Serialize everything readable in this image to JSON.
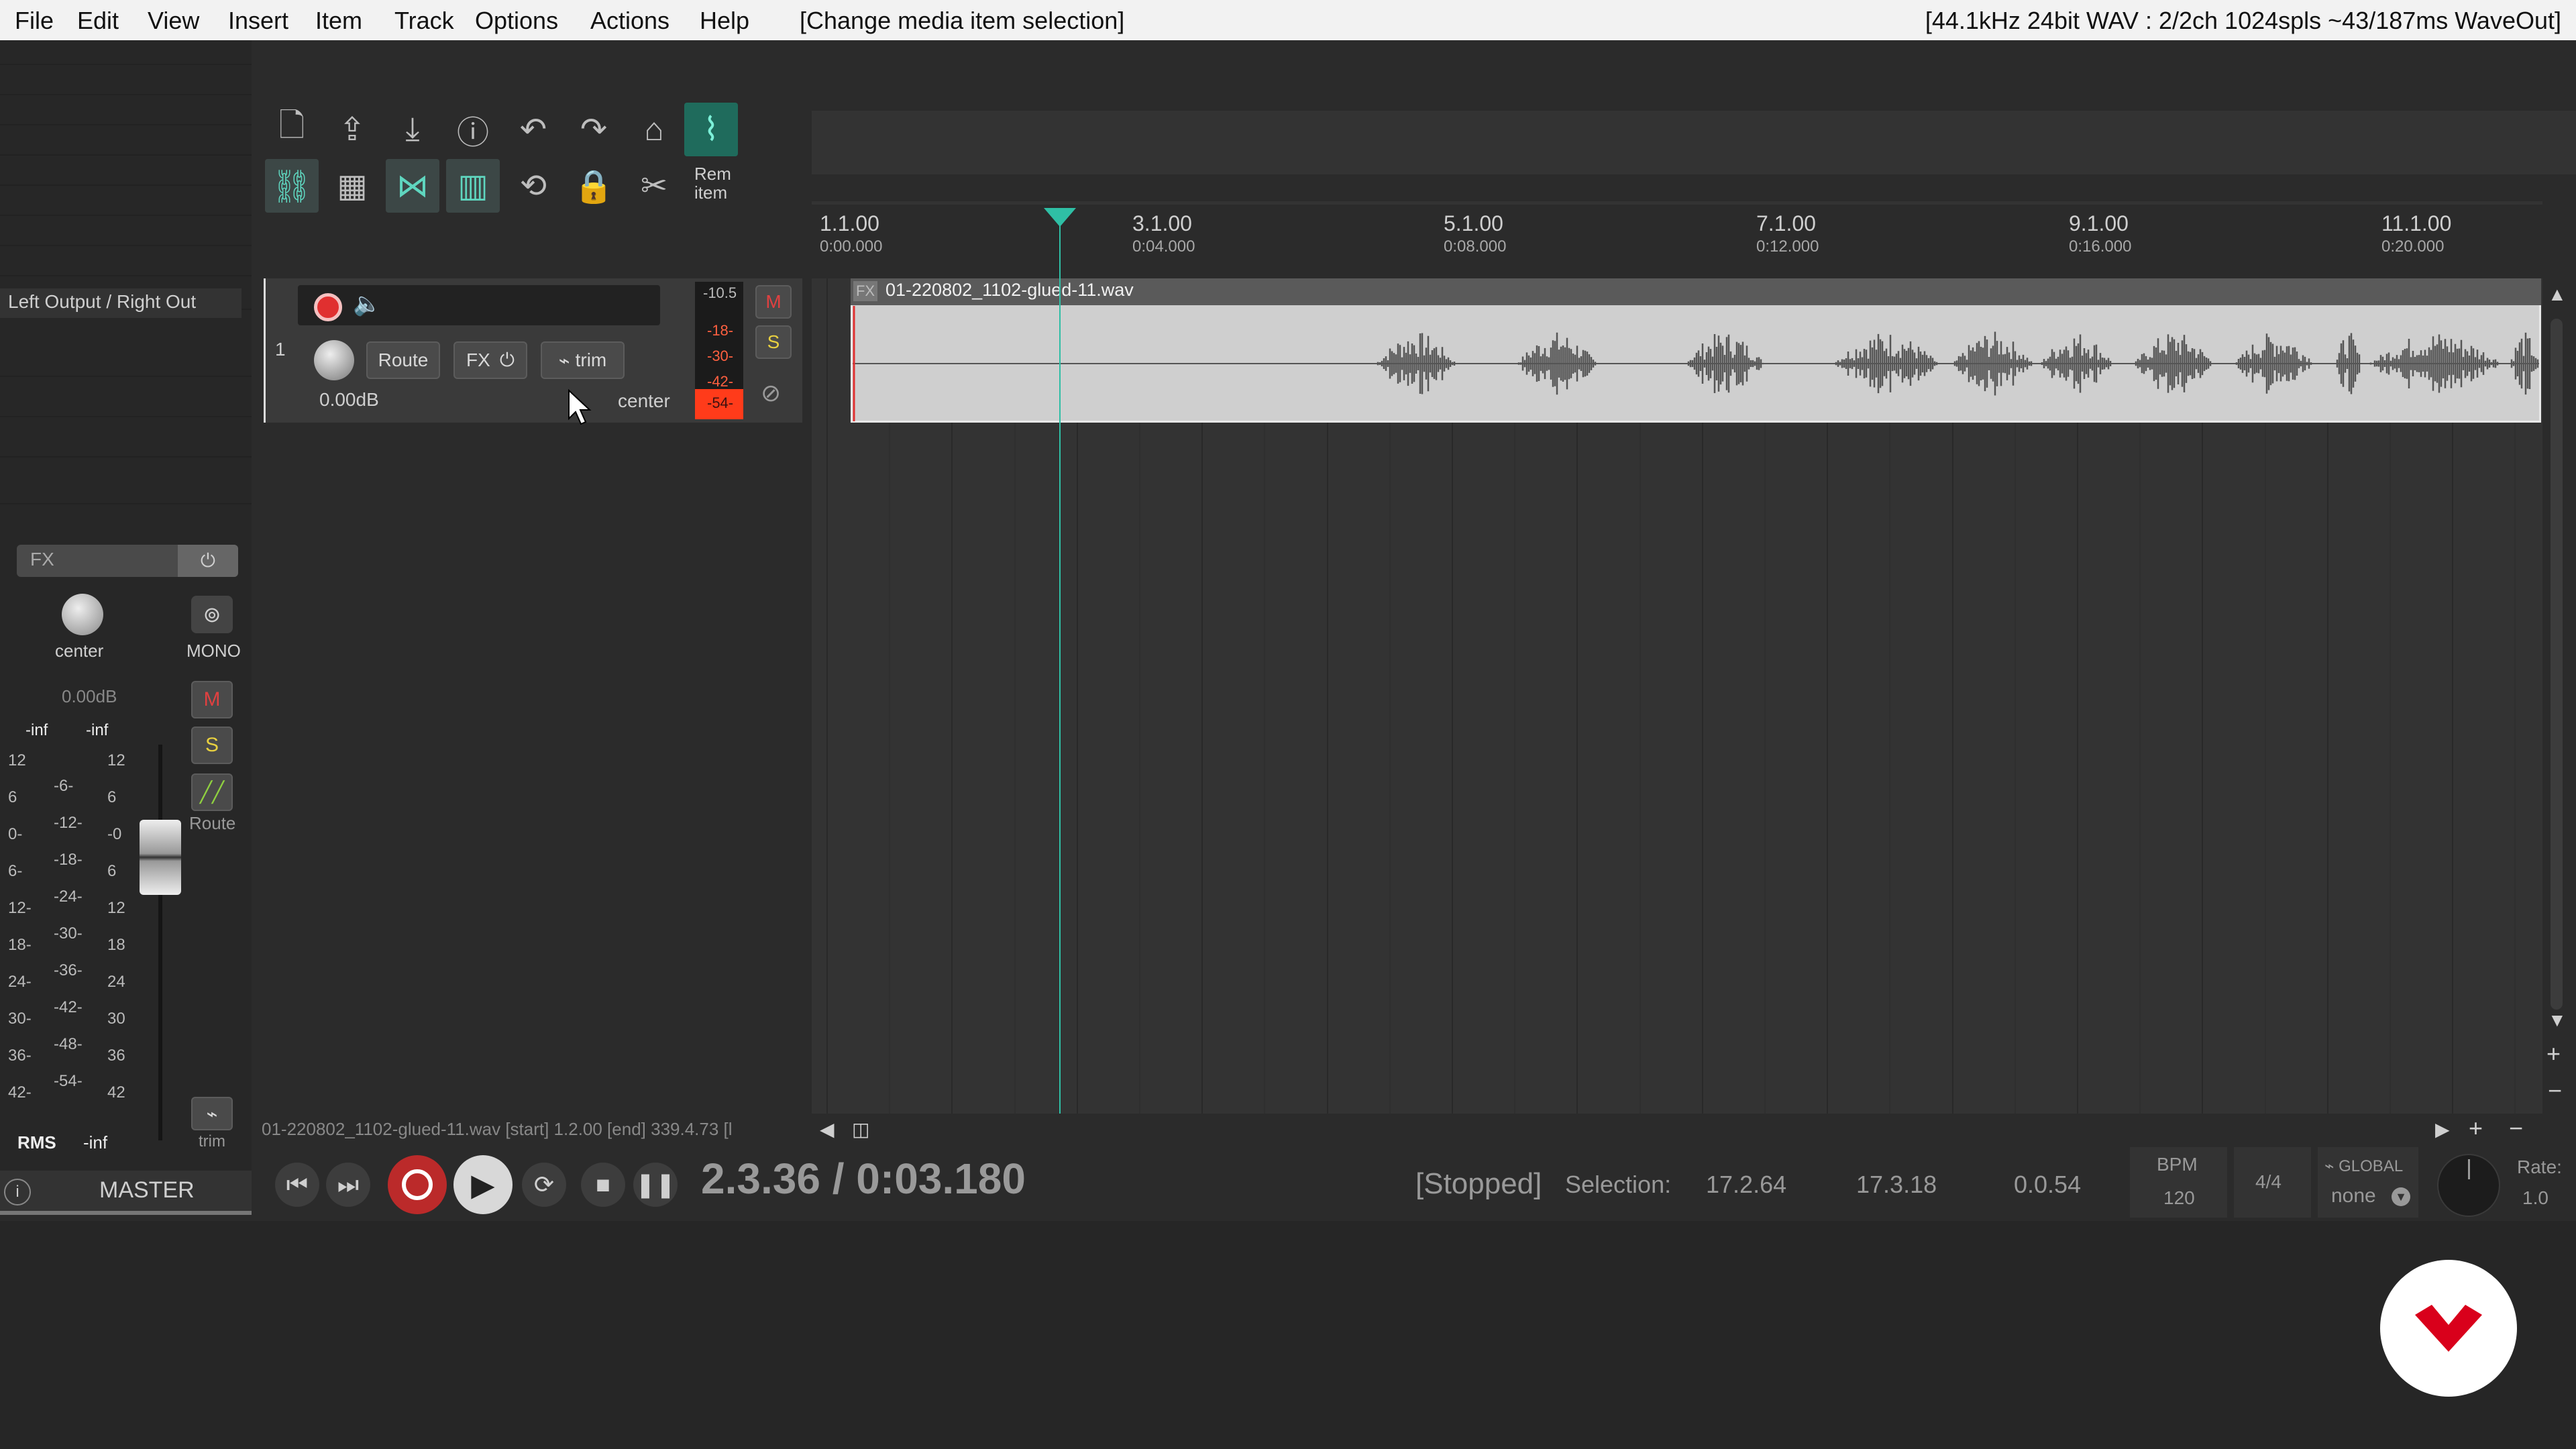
{
  "menubar": {
    "items": [
      "File",
      "Edit",
      "View",
      "Insert",
      "Item",
      "Track",
      "Options",
      "Actions",
      "Help"
    ],
    "undo_hint": "[Change media item selection]",
    "audio_status": "[44.1kHz 24bit WAV : 2/2ch 1024spls ~43/187ms WaveOut]"
  },
  "master": {
    "output_label": "Left Output / Right Out",
    "fx_label": "FX",
    "pan_label": "center",
    "mono_label": "MONO",
    "volume_db": "0.00dB",
    "mute_label": "M",
    "solo_label": "S",
    "route_label": "Route",
    "trim_label": "trim",
    "peak_left": "-inf",
    "peak_right": "-inf",
    "rms_label": "RMS",
    "rms_value": "-inf",
    "name": "MASTER",
    "scale_left": [
      "12",
      "6",
      "0-",
      "6-",
      "12-",
      "18-",
      "24-",
      "30-",
      "36-",
      "42-"
    ],
    "scale_mid": [
      "-6-",
      "-12-",
      "-18-",
      "-24-",
      "-30-",
      "-36-",
      "-42-",
      "-48-",
      "-54-"
    ],
    "scale_right": [
      "12",
      "6",
      "-0",
      "6",
      "12",
      "18",
      "24",
      "30",
      "36",
      "42"
    ]
  },
  "toolbar": {
    "rem_item": "Rem\nitem"
  },
  "track": {
    "number": "1",
    "route_label": "Route",
    "fx_label": "FX",
    "trim_label": "trim",
    "volume_db": "0.00dB",
    "pan_label": "center",
    "mute_label": "M",
    "solo_label": "S",
    "meter_labels": [
      "-10.5",
      "-18-",
      "-30-",
      "-42-",
      "-54-"
    ]
  },
  "ruler": {
    "ticks": [
      {
        "bar": "1.1.00",
        "time": "0:00.000"
      },
      {
        "bar": "3.1.00",
        "time": "0:04.000"
      },
      {
        "bar": "5.1.00",
        "time": "0:08.000"
      },
      {
        "bar": "7.1.00",
        "time": "0:12.000"
      },
      {
        "bar": "9.1.00",
        "time": "0:16.000"
      },
      {
        "bar": "11.1.00",
        "time": "0:20.000"
      }
    ]
  },
  "item": {
    "name": "01-220802_1102-glued-11.wav",
    "fx_tag": "FX"
  },
  "status_line": "01-220802_1102-glued-11.wav [start] 1.2.00 [end] 339.4.73 [l",
  "transport": {
    "position": "2.3.36 / 0:03.180",
    "state": "[Stopped]",
    "selection_label": "Selection:",
    "sel_start": "17.2.64",
    "sel_end": "17.3.18",
    "sel_length": "0.0.54",
    "bpm_label": "BPM",
    "bpm": "120",
    "timesig": "4/4",
    "global_label": "GLOBAL",
    "global_value": "none",
    "rate_label": "Rate:",
    "rate_value": "1.0"
  },
  "colors": {
    "accent": "#1f6b5c",
    "record": "#e03030",
    "meter_red": "#ff3b1a",
    "logo": "#d9001b"
  }
}
